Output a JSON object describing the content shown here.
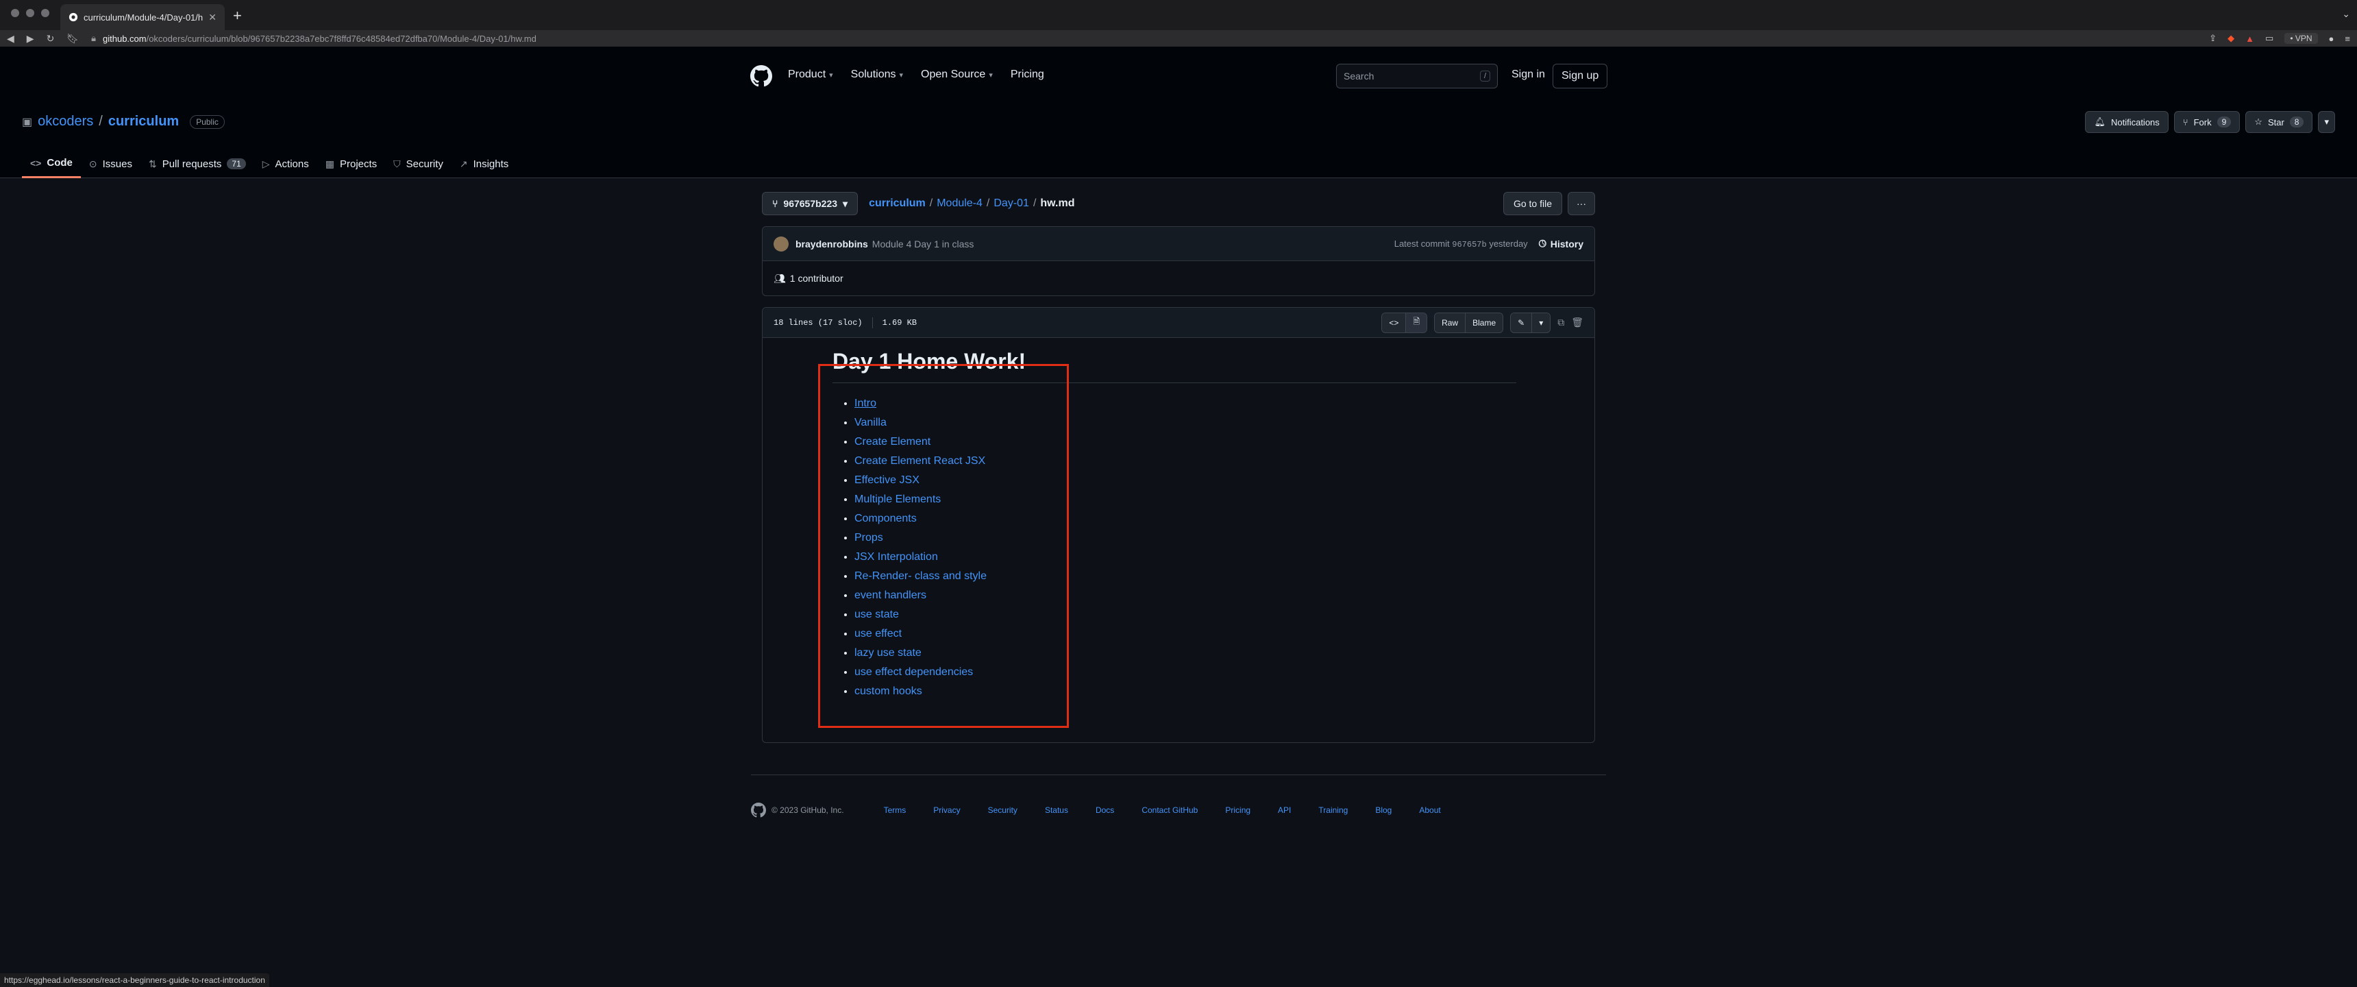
{
  "browser": {
    "tab_title": "curriculum/Module-4/Day-01/hw.md",
    "url_host": "github.com",
    "url_path": "/okcoders/curriculum/blob/967657b2238a7ebc7f8ffd76c48584ed72dfba70/Module-4/Day-01/hw.md",
    "vpn_label": "• VPN",
    "status_url": "https://egghead.io/lessons/react-a-beginners-guide-to-react-introduction"
  },
  "header": {
    "nav": [
      "Product",
      "Solutions",
      "Open Source",
      "Pricing"
    ],
    "search_placeholder": "Search",
    "search_key": "/",
    "sign_in": "Sign in",
    "sign_up": "Sign up"
  },
  "repo": {
    "owner": "okcoders",
    "separator": "/",
    "name": "curriculum",
    "visibility": "Public",
    "notifications_label": "Notifications",
    "fork_label": "Fork",
    "fork_count": "9",
    "star_label": "Star",
    "star_count": "8",
    "tabs": [
      {
        "label": "Code",
        "icon": "code-icon"
      },
      {
        "label": "Issues",
        "icon": "issue-icon"
      },
      {
        "label": "Pull requests",
        "icon": "pull-request-icon",
        "count": "71"
      },
      {
        "label": "Actions",
        "icon": "actions-icon"
      },
      {
        "label": "Projects",
        "icon": "projects-icon"
      },
      {
        "label": "Security",
        "icon": "shield-icon"
      },
      {
        "label": "Insights",
        "icon": "graph-icon"
      }
    ]
  },
  "file": {
    "branch": "967657b223",
    "path": [
      "curriculum",
      "Module-4",
      "Day-01"
    ],
    "filename": "hw.md",
    "go_to_file": "Go to file",
    "more": "···",
    "commit_author": "braydenrobbins",
    "commit_message": "Module 4 Day 1 in class",
    "latest_commit_label": "Latest commit",
    "commit_sha": "967657b",
    "commit_time": "yesterday",
    "history_label": "History",
    "contributors": "1 contributor",
    "lines": "18 lines (17 sloc)",
    "size": "1.69 KB",
    "raw_label": "Raw",
    "blame_label": "Blame"
  },
  "markdown": {
    "heading": "Day 1 Home Work!",
    "items": [
      "Intro",
      "Vanilla",
      "Create Element",
      "Create Element React JSX",
      "Effective JSX",
      "Multiple Elements",
      "Components",
      "Props",
      "JSX Interpolation",
      "Re-Render",
      "event handlers",
      "use state",
      "use effect",
      "lazy use state",
      "use effect dependencies",
      "custom hooks"
    ],
    "rerender_suffix": "- class and style"
  },
  "footer": {
    "copyright": "© 2023 GitHub, Inc.",
    "links": [
      "Terms",
      "Privacy",
      "Security",
      "Status",
      "Docs",
      "Contact GitHub",
      "Pricing",
      "API",
      "Training",
      "Blog",
      "About"
    ]
  },
  "colors": {
    "link": "#4493f8",
    "highlight_box": "#e02e16",
    "active_tab_underline": "#f78166"
  }
}
